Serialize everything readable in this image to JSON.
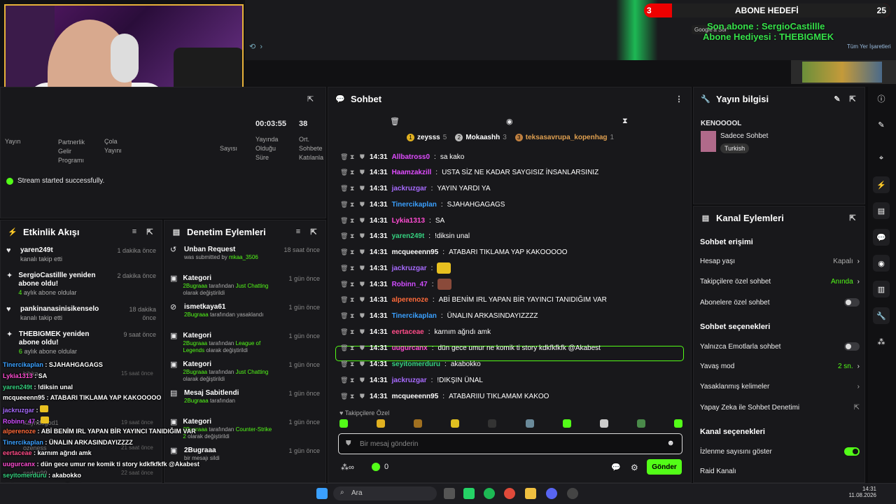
{
  "browser": {
    "google": "Google'a Sor",
    "bookmarks": "Tüm Yer İşaretleri"
  },
  "goal": {
    "title": "ABONE HEDEFİ",
    "current": "3",
    "target": "25"
  },
  "overlay_sub": {
    "last": "Son abone : SergioCastillle",
    "gift": "Abone Hediyesi : THEBIGMEK"
  },
  "stats": {
    "duration": "00:03:55",
    "duration_label_lines": [
      "Yayında",
      "Olduğu",
      "Süre"
    ],
    "avg": "38",
    "avg_label_lines": [
      "Ort.",
      "Sohbete",
      "Katılanla"
    ],
    "partner_lines": [
      "Partnerlik",
      "Gelir",
      "Programı"
    ],
    "sayisi": "Sayısı",
    "yayin": "Yayın",
    "cola": "Çola",
    "yayini": "Yayını",
    "toast": "Stream started successfully."
  },
  "activity": {
    "title": "Etkinlik Akışı",
    "items": [
      {
        "name": "yaren249t",
        "sub": "kanalı takip etti",
        "time": "1 dakika önce"
      },
      {
        "name": "SergioCastillle yeniden abone oldu!",
        "sub_num": "4",
        "sub": "aylık abone oldular",
        "time": "2 dakika önce"
      },
      {
        "name": "pankinanasinisikenselo",
        "sub": "kanalı takip etti",
        "time": "18 dakika önce"
      },
      {
        "name": "THEBIGMEK yeniden abone oldu!",
        "sub_num": "6",
        "sub": "aylık abone oldular",
        "time": "9 saat önce"
      }
    ],
    "ghost": [
      {
        "name": "bibka",
        "time": "15 saat önce"
      },
      {
        "name": "Kayndogod1",
        "time": "19 saat önce"
      },
      {
        "name": "ozeness",
        "time": "21 saat önce"
      },
      {
        "name": "sodan99",
        "time": "22 saat önce"
      }
    ]
  },
  "moderation": {
    "title": "Denetim Eylemleri",
    "items": [
      {
        "title": "Unban Request",
        "line": "was submitted by",
        "who": "mkaa_3506",
        "time": "18 saat önce"
      },
      {
        "title": "Kategori",
        "who": "2Bugraaa",
        "line": "tarafından",
        "cat": "Just Chatting",
        "line2": "olarak değiştirildi",
        "time": "1 gün önce"
      },
      {
        "title": "ismetkaya61",
        "who": "2Bugraaa",
        "line": "tarafından yasaklandı",
        "time": "1 gün önce"
      },
      {
        "title": "Kategori",
        "who": "2Bugraaa",
        "line": "tarafından",
        "cat": "League of Legends",
        "line2": "olarak değiştirildi",
        "time": "1 gün önce"
      },
      {
        "title": "Kategori",
        "who": "2Bugraaa",
        "line": "tarafından",
        "cat": "Just Chatting",
        "line2": "olarak değiştirildi",
        "time": "1 gün önce"
      },
      {
        "title": "Mesaj Sabitlendi",
        "who": "2Bugraaa",
        "line": "tarafından",
        "time": "1 gün önce"
      },
      {
        "title": "Kategori",
        "who": "2Bugraaa",
        "line": "tarafından",
        "cat": "Counter-Strike 2",
        "line2": "olarak değiştirildi",
        "time": "1 gün önce"
      },
      {
        "title": "2Bugraaa",
        "line": "bir mesajı sildi",
        "time": "1 gün önce"
      }
    ]
  },
  "chat": {
    "title": "Sohbet",
    "top": [
      {
        "rank": "1",
        "name": "zeysss",
        "n": "5"
      },
      {
        "rank": "2",
        "name": "Mokaashh",
        "n": "3"
      },
      {
        "rank": "3",
        "name": "teksasavrupa_kopenhag",
        "n": "1"
      }
    ],
    "messages": [
      {
        "time": "14:31",
        "user": "Allbatross0",
        "color": "#e04cff",
        "text": "sa kako"
      },
      {
        "time": "14:31",
        "user": "Haamzakzill",
        "color": "#e04cff",
        "text": "USTA SİZ NE KADAR SAYGISIZ İNSANLARSINIZ"
      },
      {
        "time": "14:31",
        "user": "jackruzgar",
        "color": "#a86bff",
        "text": "YAYIN YARDI YA"
      },
      {
        "time": "14:31",
        "user": "Tinercikaplan",
        "color": "#3aa0ff",
        "text": "SJAHAHGAGAGS"
      },
      {
        "time": "14:31",
        "user": "Lykia1313",
        "color": "#ff4cd2",
        "text": "SA"
      },
      {
        "time": "14:31",
        "user": "yaren249t",
        "color": "#35d07f",
        "text": "!diksin unal"
      },
      {
        "time": "14:31",
        "user": "mcqueeenn95",
        "color": "#ffffff",
        "text": "ATABARI TIKLAMA YAP KAKOOOOO"
      },
      {
        "time": "14:31",
        "user": "jackruzgar",
        "color": "#a86bff",
        "text": ""
      },
      {
        "time": "14:31",
        "user": "Robinn_47",
        "color": "#d04cff",
        "text": ""
      },
      {
        "time": "14:31",
        "user": "alperenoze",
        "color": "#ff6a3a",
        "text": "ABİ BENİM IRL YAPAN BİR YAYINCI TANIDIĞIM VAR"
      },
      {
        "time": "14:31",
        "user": "Tinercikaplan",
        "color": "#3aa0ff",
        "text": "ÜNALIN ARKASINDAYIZZZZ"
      },
      {
        "time": "14:31",
        "user": "eertaceae",
        "color": "#ff4c88",
        "text": "karnım ağrıdı amk"
      },
      {
        "time": "14:31",
        "user": "uugurcanx",
        "color": "#ff4cd2",
        "text": "dün gece umur ne komik ti story kdkfkfkfk @Akabest"
      },
      {
        "time": "14:31",
        "user": "seyitomerduru",
        "color": "#35d07f",
        "text": "akabokko"
      },
      {
        "time": "14:31",
        "user": "jackruzgar",
        "color": "#a86bff",
        "text": "!DIKŞIN ÜNAL"
      },
      {
        "time": "14:31",
        "user": "mcqueeenn95",
        "color": "#ffffff",
        "text": "ATABARIIU TIKLAMAM KAKOO"
      }
    ],
    "followers_only": "Takipçilere Özel",
    "placeholder": "Bir mesaj gönderin",
    "send": "Gönder",
    "points": "0"
  },
  "info": {
    "title": "Yayın bilgisi",
    "channel": "KENOOOOL",
    "sub": "Sadece Sohbet",
    "lang": "Turkish"
  },
  "actions": {
    "title": "Kanal Eylemleri",
    "chat_access": "Sohbet erişimi",
    "account_age": "Hesap yaşı",
    "account_age_v": "Kapalı",
    "followers": "Takipçilere özel sohbet",
    "followers_v": "Anında",
    "subs": "Abonelere özel sohbet",
    "options": "Sohbet seçenekleri",
    "emotes": "Yalnızca Emotlarla sohbet",
    "slow": "Yavaş mod",
    "slow_v": "2 sn.",
    "banned": "Yasaklanmış kelimeler",
    "ai": "Yapay Zeka ile Sohbet Denetimi",
    "channel_opts": "Kanal seçenekleri",
    "viewers": "İzlenme sayısını göster",
    "raid": "Raid Kanalı"
  },
  "overlay_chat": [
    {
      "user": "Tinercikaplan",
      "color": "#3aa0ff",
      "text": "SJAHAHGAGAGS"
    },
    {
      "user": "Lykia1313",
      "color": "#ff4cd2",
      "text": "SA"
    },
    {
      "user": "yaren249t",
      "color": "#35d07f",
      "text": "!diksin unal"
    },
    {
      "user": "mcqueeenn95",
      "color": "#ffffff",
      "text": "ATABARI TIKLAMA YAP KAKOOOOO"
    },
    {
      "user": "jackruzgar",
      "color": "#a86bff",
      "text": ""
    },
    {
      "user": "Robinn_47",
      "color": "#d04cff",
      "text": ""
    },
    {
      "user": "alperenoze",
      "color": "#ff6a3a",
      "text": "ABİ BENİM IRL YAPAN BİR YAYINCI TANIDIĞIM VAR"
    },
    {
      "user": "Tinercikaplan",
      "color": "#3aa0ff",
      "text": "ÜNALIN ARKASINDAYIZZZZ"
    },
    {
      "user": "eertaceae",
      "color": "#ff4c88",
      "text": "karnım ağrıdı amk"
    },
    {
      "user": "uugurcanx",
      "color": "#ff4cd2",
      "text": "dün gece umur ne komik ti story kdkfkfkfk @Akabest"
    },
    {
      "user": "seyitomerduru",
      "color": "#35d07f",
      "text": "akabokko"
    },
    {
      "user": "jackruzgar",
      "color": "#a86bff",
      "text": "!DIKŞIN ÜNAL"
    },
    {
      "user": "mcqueeenn95",
      "color": "#ffffff",
      "text": "ATABARIIU TIKLAMAM KAKOO"
    }
  ],
  "taskbar": {
    "search": "Ara",
    "time": "14:31",
    "date": "11.08.2026"
  }
}
